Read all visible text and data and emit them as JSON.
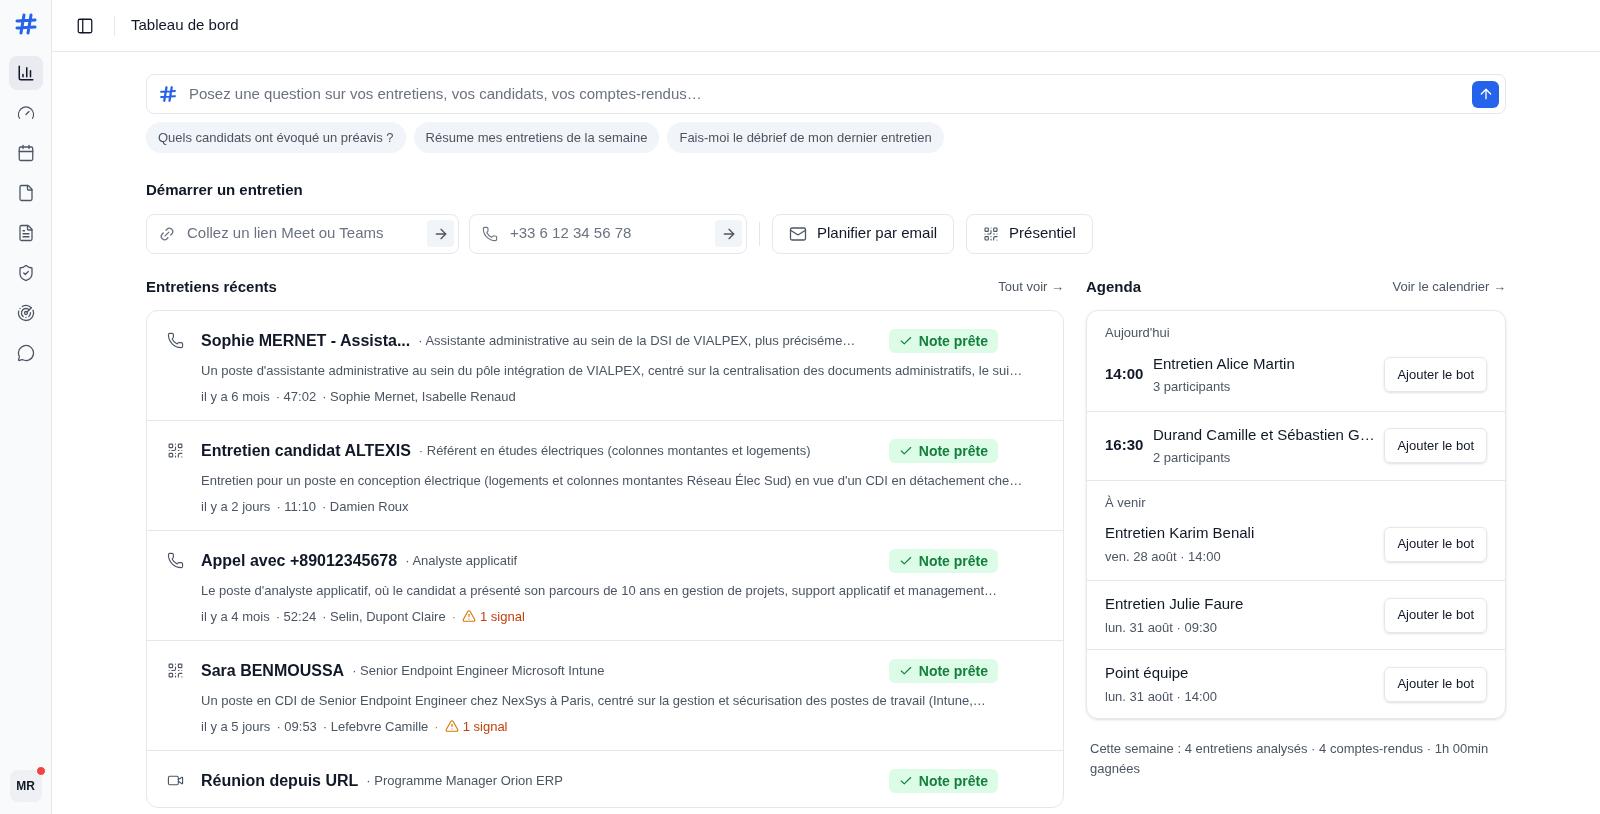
{
  "sidebar": {
    "items": [
      {
        "selected": true
      },
      {
        "selected": false
      },
      {
        "selected": false
      },
      {
        "selected": false
      },
      {
        "selected": false
      },
      {
        "selected": false
      },
      {
        "selected": false
      },
      {
        "selected": false
      }
    ],
    "avatar": {
      "initials": "MR",
      "notification": true
    }
  },
  "header": {
    "title": "Tableau de bord"
  },
  "ask": {
    "placeholder": "Posez une question sur vos entretiens, vos candidats, vos comptes-rendus…",
    "suggestions": [
      "Quels candidats ont évoqué un préavis ?",
      "Résume mes entretiens de la semaine",
      "Fais-moi le débrief de mon dernier entretien"
    ]
  },
  "start": {
    "title": "Démarrer un entretien",
    "link_placeholder": "Collez un lien Meet ou Teams",
    "phone_placeholder": "+33 6 12 34 56 78",
    "email_button": "Planifier par email",
    "inperson_button": "Présentiel"
  },
  "recent": {
    "title": "Entretiens récents",
    "see_all": "Tout voir →",
    "items": [
      {
        "kind": "phone",
        "title": "Sophie MERNET - Assista...",
        "subtitle": "· Assistante administrative au sein de la DSI de VIALPEX, plus préciséme…",
        "badge": "Note prête",
        "description": "Un poste d'assistante administrative au sein du pôle intégration de VIALPEX, centré sur la centralisation des documents administratifs, le sui…",
        "meta": [
          "il y a 6 mois",
          "· 47:02",
          "· Sophie Mernet, Isabelle Renaud"
        ]
      },
      {
        "kind": "qr",
        "title": "Entretien candidat ALTEXIS",
        "subtitle": "· Référent en études électriques (colonnes montantes et logements)",
        "badge": "Note prête",
        "description": "Entretien pour un poste en conception électrique (logements et colonnes montantes Réseau Élec Sud) en vue d'un CDI en détachement che…",
        "meta": [
          "il y a 2 jours",
          "· 11:10",
          "· Damien Roux"
        ]
      },
      {
        "kind": "phone",
        "title": "Appel avec +89012345678",
        "subtitle": "· Analyste applicatif",
        "badge": "Note prête",
        "description": "Le poste d'analyste applicatif, où le candidat a présenté son parcours de 10 ans en gestion de projets, support applicatif et management…",
        "meta": [
          "il y a 4 mois",
          "· 52:24",
          "· Selin, Dupont Claire"
        ],
        "signal": {
          "separator": "·",
          "label": "1 signal"
        }
      },
      {
        "kind": "qr",
        "title": "Sara BENMOUSSA",
        "subtitle": "· Senior Endpoint Engineer Microsoft Intune",
        "badge": "Note prête",
        "description": "Un poste en CDI de Senior Endpoint Engineer chez NexSys à Paris, centré sur la gestion et sécurisation des postes de travail (Intune,…",
        "meta": [
          "il y a 5 jours",
          "· 09:53",
          "· Lefebvre Camille"
        ],
        "signal": {
          "separator": "·",
          "label": "1 signal"
        }
      },
      {
        "kind": "video",
        "title": "Réunion depuis URL",
        "subtitle": "· Programme Manager Orion ERP",
        "badge": "Note prête"
      }
    ]
  },
  "agenda": {
    "title": "Agenda",
    "see_all": "Voir le calendrier →",
    "sections": [
      {
        "label": "Aujourd'hui",
        "items": [
          {
            "time": "14:00",
            "title": "Entretien Alice Martin",
            "subtitle": "3 participants",
            "button": "Ajouter le bot"
          },
          {
            "time": "16:30",
            "title": "Durand Camille et Sébastien G…",
            "subtitle": "2 participants",
            "button": "Ajouter le bot"
          }
        ]
      },
      {
        "label": "À venir",
        "items": [
          {
            "title": "Entretien Karim Benali",
            "subtitle": "ven. 28 août · 14:00",
            "button": "Ajouter le bot"
          },
          {
            "title": "Entretien Julie Faure",
            "subtitle": "lun. 31 août · 09:30",
            "button": "Ajouter le bot"
          },
          {
            "title": "Point équipe",
            "subtitle": "lun. 31 août · 14:00",
            "button": "Ajouter le bot"
          }
        ]
      }
    ],
    "footer": "Cette semaine : 4 entretiens analysés · 4 comptes-rendus · 1h 00min gagnées"
  }
}
